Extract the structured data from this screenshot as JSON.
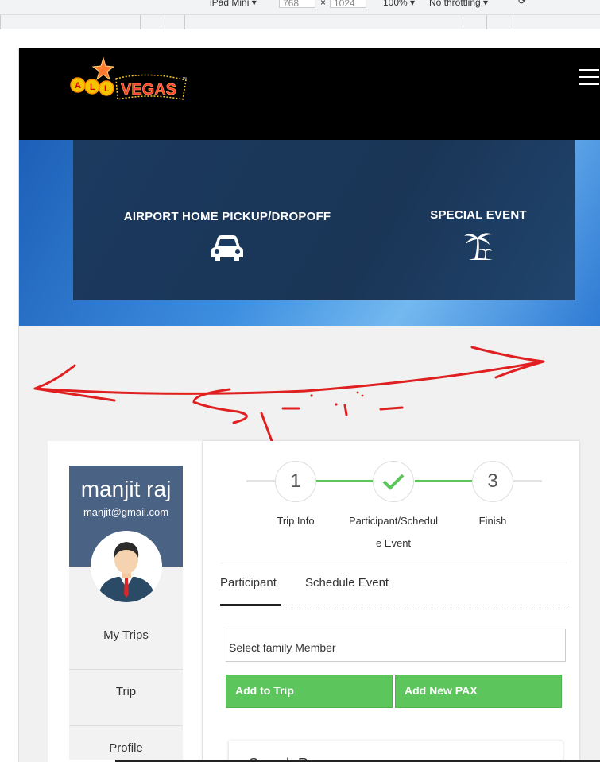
{
  "devtools": {
    "device": "iPad Mini",
    "width": "768",
    "height": "1024",
    "times": "×",
    "zoom": "100%",
    "throttle": "No throttling"
  },
  "brand": {
    "logo_text_small": "ALL",
    "logo_text_big": "VEGAS",
    "logo_tm": "™"
  },
  "services": [
    {
      "label": "AIRPORT HOME PICKUP/DROPOFF",
      "icon": "car-icon"
    },
    {
      "label": "SPECIAL EVENT",
      "icon": "palm-tree-icon"
    }
  ],
  "scribble_color": "#e02020",
  "profile": {
    "name": "manjit raj",
    "email": "manjit@gmail.com"
  },
  "sidebar": {
    "items": [
      {
        "label": "My Trips"
      },
      {
        "label": "Trip"
      },
      {
        "label": "Profile"
      }
    ]
  },
  "wizard": {
    "steps": [
      {
        "number": "1",
        "label": "Trip Info",
        "state": "pending"
      },
      {
        "number": "",
        "label_line1": "Participant/Schedul",
        "label_line2": "e Event",
        "state": "done"
      },
      {
        "number": "3",
        "label": "Finish",
        "state": "pending"
      }
    ],
    "completed_color": "#5cc55b"
  },
  "tabs": [
    {
      "label": "Participant",
      "active": true
    },
    {
      "label": "Schedule Event",
      "active": false
    }
  ],
  "form": {
    "family_select": "Select family Member",
    "add_to_trip": "Add to Trip",
    "add_new_pax": "Add New PAX"
  },
  "section_title": "Search Resu",
  "colors": {
    "navbar": "#000000",
    "accent_green": "#5cc55b",
    "profile_bg": "#4a6284",
    "hero_panel": "#1b3a5f"
  }
}
